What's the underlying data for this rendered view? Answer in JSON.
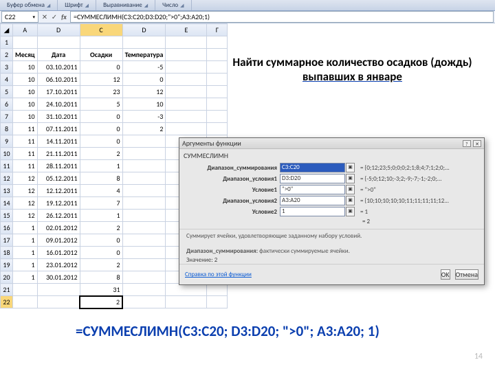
{
  "ribbon": {
    "g1": "Буфер обмена",
    "g2": "Шрифт",
    "g3": "Выравнивание",
    "g4": "Число"
  },
  "formula_bar": {
    "cellref": "C22",
    "formula": "=СУММЕСЛИМН(C3:C20;D3:D20;\">0\";A3:A20;1)"
  },
  "headers": [
    "",
    "A",
    "D",
    "C",
    "D",
    "E",
    "Г"
  ],
  "titles": {
    "mes": "Месяц",
    "data": "Дата",
    "os": "Осадки",
    "temp": "Температура"
  },
  "rows": [
    {
      "n": "3",
      "a": "10",
      "b": "03.10.2011",
      "c": "0",
      "d": "-5"
    },
    {
      "n": "4",
      "a": "10",
      "b": "06.10.2011",
      "c": "12",
      "d": "0"
    },
    {
      "n": "5",
      "a": "10",
      "b": "17.10.2011",
      "c": "23",
      "d": "12"
    },
    {
      "n": "6",
      "a": "10",
      "b": "24.10.2011",
      "c": "5",
      "d": "10"
    },
    {
      "n": "7",
      "a": "10",
      "b": "31.10.2011",
      "c": "0",
      "d": "-3"
    },
    {
      "n": "8",
      "a": "11",
      "b": "07.11.2011",
      "c": "0",
      "d": "2"
    },
    {
      "n": "9",
      "a": "11",
      "b": "14.11.2011",
      "c": "0",
      "d": ""
    },
    {
      "n": "10",
      "a": "11",
      "b": "21.11.2011",
      "c": "2",
      "d": ""
    },
    {
      "n": "11",
      "a": "11",
      "b": "28.11.2011",
      "c": "1",
      "d": ""
    },
    {
      "n": "12",
      "a": "12",
      "b": "05.12.2011",
      "c": "8",
      "d": ""
    },
    {
      "n": "13",
      "a": "12",
      "b": "12.12.2011",
      "c": "4",
      "d": ""
    },
    {
      "n": "14",
      "a": "12",
      "b": "19.12.2011",
      "c": "7",
      "d": ""
    },
    {
      "n": "15",
      "a": "12",
      "b": "26.12.2011",
      "c": "1",
      "d": ""
    },
    {
      "n": "16",
      "a": "1",
      "b": "02.01.2012",
      "c": "2",
      "d": ""
    },
    {
      "n": "17",
      "a": "1",
      "b": "09.01.2012",
      "c": "0",
      "d": ""
    },
    {
      "n": "18",
      "a": "1",
      "b": "16.01.2012",
      "c": "0",
      "d": ""
    },
    {
      "n": "19",
      "a": "1",
      "b": "23.01.2012",
      "c": "2",
      "d": ""
    },
    {
      "n": "20",
      "a": "1",
      "b": "30.01.2012",
      "c": "8",
      "d": ""
    }
  ],
  "row21": {
    "n": "21",
    "c": "31"
  },
  "row22": {
    "n": "22",
    "c": "2"
  },
  "task": {
    "line1": "Найти суммарное количество осадков (дождь)",
    "line2": "выпавших в январе"
  },
  "dialog": {
    "title": "Аргументы функции",
    "func": "СУММЕСЛИМН",
    "args": [
      {
        "label": "Диапазон_суммирования",
        "value": "C3:C20",
        "sel": true,
        "res": "= {0;12;23;5;0;0;0;2;1;8;4;7;1;2;0;..."
      },
      {
        "label": "Диапазон_условия1",
        "value": "D3:D20",
        "res": "= {-5;0;12;10;-3;2;-9;-7;-1;-2;0;..."
      },
      {
        "label": "Условие1",
        "value": "\">0\"",
        "res": "= \">0\""
      },
      {
        "label": "Диапазон_условия2",
        "value": "A3:A20",
        "res": "= {10;10;10;10;10;11;11;11;11;12..."
      },
      {
        "label": "Условие2",
        "value": "1",
        "res": "= 1"
      }
    ],
    "eqres": "= 2",
    "desc": "Суммирует ячейки, удовлетворяющие заданному набору условий.",
    "desc2lbl": "Диапазон_суммирования:",
    "desc2": "фактически суммируемые ячейки.",
    "value_lbl": "Значение:",
    "value": "2",
    "help": "Справка по этой функции",
    "ok": "OK",
    "cancel": "Отмена"
  },
  "bigformula": "=СУММЕСЛИМН(C3:C20; D3:D20; \">0\"; A3:A20; 1)",
  "pagenum": "14"
}
